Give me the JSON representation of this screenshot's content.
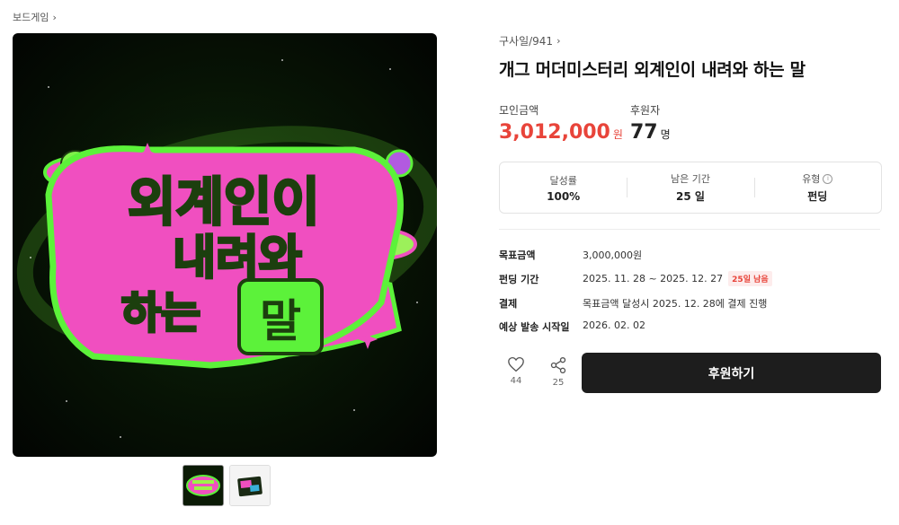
{
  "breadcrumb": {
    "category": "보드게임"
  },
  "project": {
    "creator": "구사일/941",
    "title": "개그 머더미스터리 외계인이 내려와 하는 말",
    "hero_art_text": [
      "외계인이",
      "내려와",
      "하는",
      "말"
    ]
  },
  "funding": {
    "raised_label": "모인금액",
    "raised_amount": "3,012,000",
    "raised_unit": "원",
    "backers_label": "후원자",
    "backers_count": "77",
    "backers_unit": "명"
  },
  "stats": [
    {
      "label": "달성률",
      "value": "100%"
    },
    {
      "label": "남은 기간",
      "value": "25 일"
    },
    {
      "label": "유형",
      "value": "펀딩",
      "info_icon": "i"
    }
  ],
  "details": {
    "goal_label": "목표금액",
    "goal_value": "3,000,000원",
    "period_label": "펀딩 기간",
    "period_value": "2025. 11. 28 ~ 2025. 12. 27",
    "period_badge": "25일 남음",
    "payment_label": "결제",
    "payment_value": "목표금액 달성시 2025. 12. 28에 결제 진행",
    "ship_label": "예상 발송 시작일",
    "ship_value": "2026. 02. 02"
  },
  "actions": {
    "like_count": "44",
    "share_count": "25",
    "sponsor_label": "후원하기"
  },
  "colors": {
    "accent_red": "#e8443a",
    "button_dark": "#1d1d1d",
    "art_green": "#5cf23a",
    "art_pink": "#f04fc0"
  },
  "icons": {
    "chevron": "chevron-right-icon",
    "like": "heart-icon",
    "share": "share-icon",
    "info": "info-icon"
  }
}
